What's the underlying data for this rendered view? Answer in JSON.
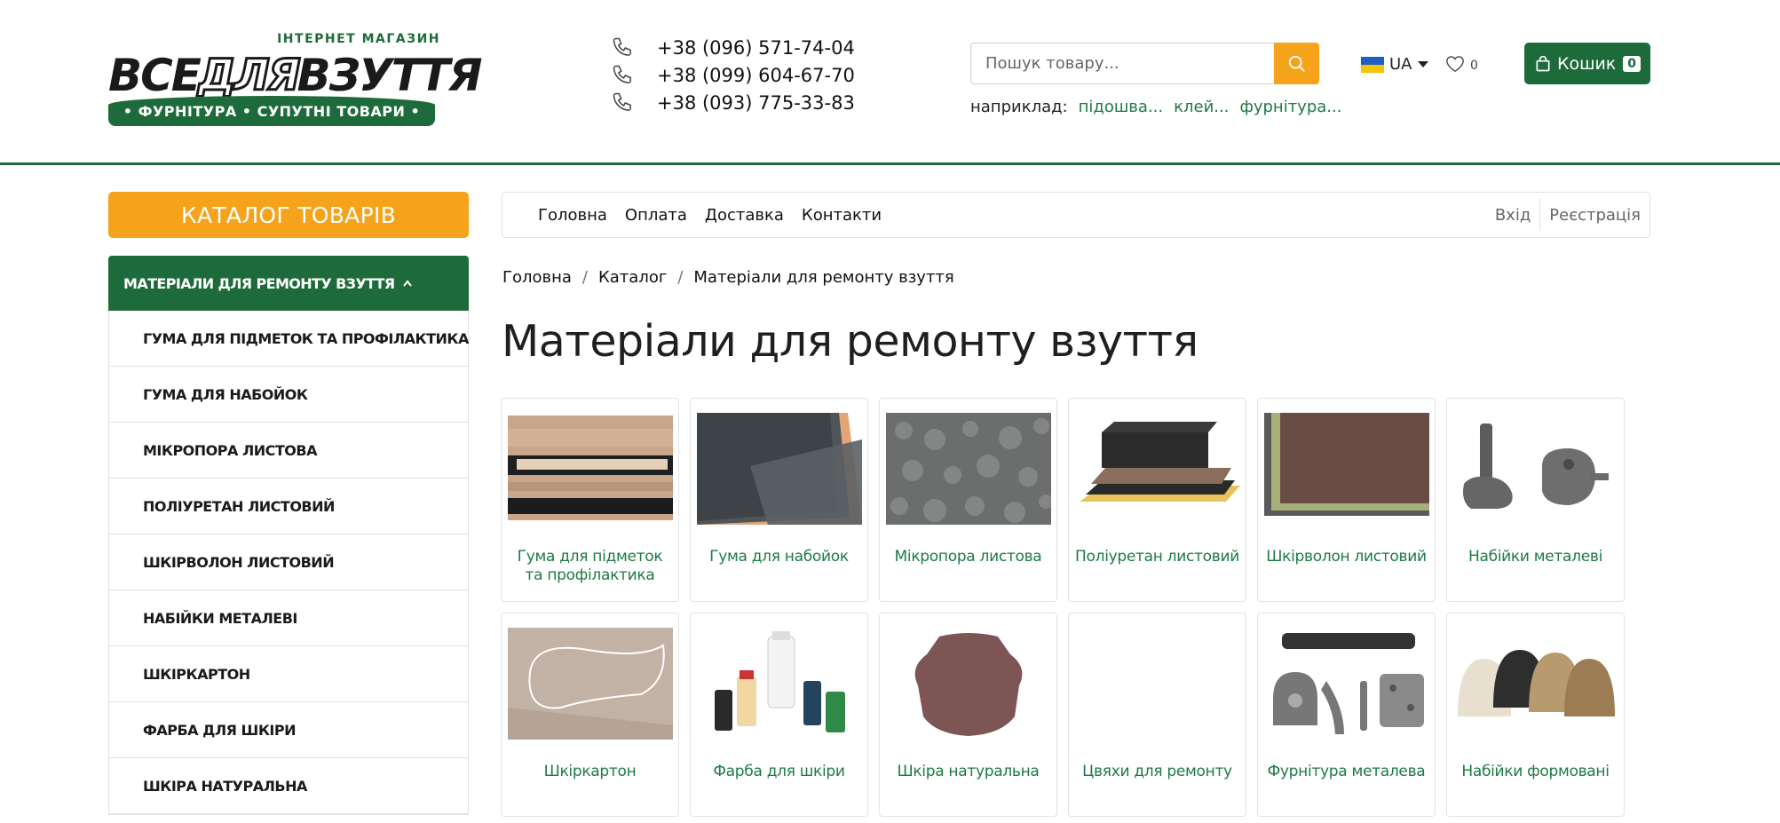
{
  "header": {
    "logo": {
      "top_text": "ІНТЕРНЕТ МАГАЗИН",
      "word1": "ВСЕ",
      "word2": "ДЛЯ",
      "word3": "ВЗУТТЯ",
      "ribbon_text": "• ФУРНІТУРА • СУПУТНІ ТОВАРИ •"
    },
    "phones": [
      "+38 (096) 571-74-04",
      "+38 (099) 604-67-70",
      "+38 (093) 775-33-83"
    ],
    "search": {
      "placeholder": "Пошук товару...",
      "examples_label": "наприклад:",
      "examples": [
        "підошва...",
        "клей...",
        "фурнітура..."
      ]
    },
    "language": "UA",
    "wishlist_count": "0",
    "cart": {
      "label": "Кошик",
      "count": "0"
    }
  },
  "sidebar": {
    "catalog_button": "КАТАЛОГ ТОВАРІВ",
    "active_category": "МАТЕРІАЛИ ДЛЯ РЕМОНТУ ВЗУТТЯ",
    "items": [
      "ГУМА ДЛЯ ПІДМЕТОК ТА ПРОФІЛАКТИКА",
      "ГУМА ДЛЯ НАБОЙОК",
      "МІКРОПОРА ЛИСТОВА",
      "ПОЛІУРЕТАН ЛИСТОВИЙ",
      "ШКІРВОЛОН ЛИСТОВИЙ",
      "НАБІЙКИ МЕТАЛЕВІ",
      "ШКІРКАРТОН",
      "ФАРБА ДЛЯ ШКІРИ",
      "ШКІРА НАТУРАЛЬНА"
    ]
  },
  "nav": {
    "links": [
      "Головна",
      "Оплата",
      "Доставка",
      "Контакти"
    ],
    "login": "Вхід",
    "register": "Реєстрація"
  },
  "breadcrumb": [
    "Головна",
    "Каталог",
    "Матеріали для ремонту взуття"
  ],
  "page_title": "Матеріали для ремонту взуття",
  "products": [
    {
      "label": "Гума для підметок та профілактика"
    },
    {
      "label": "Гума для набойок"
    },
    {
      "label": "Мікропора листова"
    },
    {
      "label": "Поліуретан листовий"
    },
    {
      "label": "Шкірволон листовий"
    },
    {
      "label": "Набійки металеві"
    },
    {
      "label": "Шкіркартон"
    },
    {
      "label": "Фарба для шкіри"
    },
    {
      "label": "Шкіра натуральна"
    },
    {
      "label": "Цвяхи для ремонту"
    },
    {
      "label": "Фурнітура металева"
    },
    {
      "label": "Набійки формовані"
    }
  ],
  "colors": {
    "brand_green": "#1d6b3a",
    "accent_orange": "#f5a31a",
    "link_green": "#1d7a45"
  }
}
